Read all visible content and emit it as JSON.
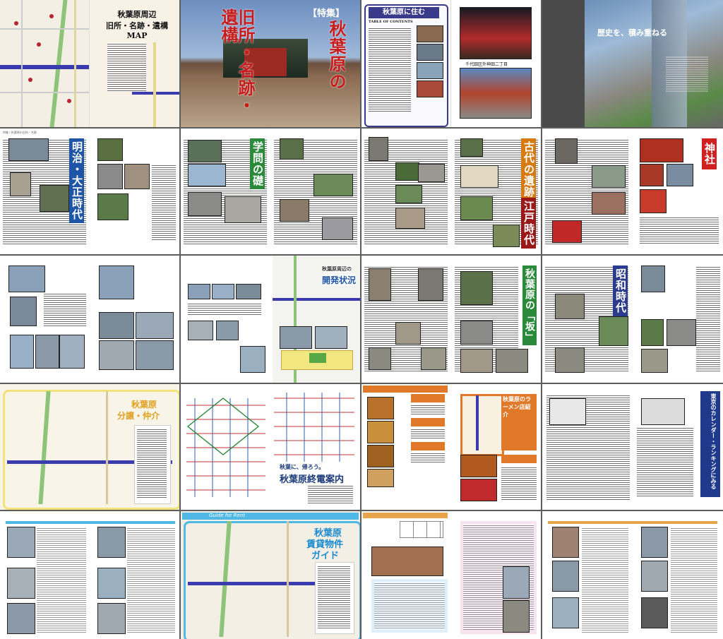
{
  "row1": {
    "map_title": "秋葉原周辺\n旧所・名跡・遺構\nMAP",
    "cover_tag": "【特集】",
    "cover_title_1": "秋葉原の",
    "cover_title_2": "旧所・名跡・遺構",
    "toc_logo": "秋葉原に住む",
    "toc_heading": "TABLE OF CONTENTS",
    "toc_caption": "千代田区外神田二丁目",
    "history_title": "歴史を、積み重ねる"
  },
  "row2": {
    "title_meiji": "明治・大正時代",
    "title_gakumon": "学問の礎",
    "title_kodai": "古代の遺跡",
    "title_edo": "江戸時代",
    "title_jinja": "神社"
  },
  "row3": {
    "dev_title_1": "秋葉原周辺の",
    "dev_title_2": "開発状況",
    "title_saka": "秋葉原の「坂」",
    "title_showa": "昭和時代"
  },
  "row4": {
    "sale_title_1": "秋葉原",
    "sale_title_2": "分譲・仲介",
    "train_title_1": "秋葉に、帰ろう。",
    "train_title_2": "秋葉原終電案内",
    "ramen_title": "秋葉原のラーメン店紹介",
    "review_title": "東京のカレンダー・ランキングにみる"
  },
  "row5": {
    "rent_title_1": "秋葉原",
    "rent_title_2": "賃貸物件",
    "rent_title_3": "ガイド",
    "ribbon": "Guide for Rent"
  },
  "colors": {
    "meiji": "#1f55a6",
    "gakumon": "#2a8a3a",
    "kodai": "#d87a12",
    "edo": "#9a1818",
    "jinja": "#d12020",
    "showa": "#2a3a8c",
    "sale": "#f2e27a",
    "rent": "#4fb8e6"
  }
}
